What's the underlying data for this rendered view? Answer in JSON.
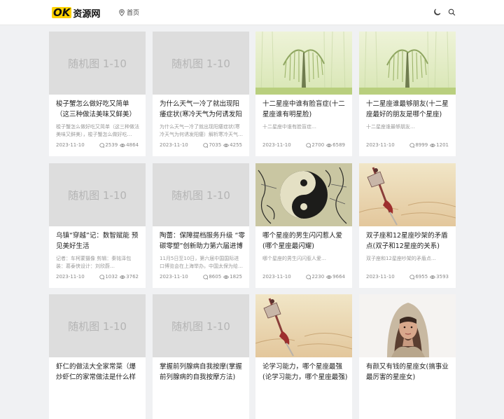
{
  "header": {
    "logo_mark": "OK",
    "logo_text": "资源网",
    "nav_home": "首页"
  },
  "placeholder_text": "随机图 1-10",
  "cards": [
    {
      "image": "placeholder",
      "title": "梭子蟹怎么做好吃又简单（这三种做法美味又鲜美）",
      "excerpt": "梭子蟹怎么做好吃又简单（这三种做法美味又鲜美），梭子蟹怎么做好吃…",
      "date": "2023-11-10",
      "comments": "2539",
      "views": "4864"
    },
    {
      "image": "placeholder",
      "title": "为什么天气一冷了就出现阳痿症状(寒冷天气为何诱发阳痿)",
      "excerpt": "为什么天气一冷了就出现阳痿症状(寒冷天气为何诱发阳痿）解析寒冷天气…",
      "date": "2023-11-10",
      "comments": "7035",
      "views": "4255"
    },
    {
      "image": "willow",
      "title": "十二星座中谁有脸盲症(十二星座谁有明星脸)",
      "excerpt": "十二星座中谁有脸盲症…",
      "date": "2023-11-10",
      "comments": "2700",
      "views": "6589"
    },
    {
      "image": "willow",
      "title": "十二星座谁最够朋友(十二星座最好的朋友是哪个星座)",
      "excerpt": "十二星座谁最够朋友…",
      "date": "2023-11-10",
      "comments": "8999",
      "views": "1201"
    },
    {
      "image": "placeholder",
      "title": "乌镇“穿越”记：数智赋能 预见美好生活",
      "excerpt": "记者：车柯蒙摄像 剪辑：秦铭泽包装：葛泰侠设计：刘欣蔚…",
      "date": "2023-11-10",
      "comments": "1032",
      "views": "3762"
    },
    {
      "image": "placeholder",
      "title": "陶蕾：保障提档服务升级 “零碳零塑”创新助力第六届进博会",
      "excerpt": "11月5日至10日，第六届中国国际进口博览会在上海举办。中国太保为给…",
      "date": "2023-11-10",
      "comments": "8605",
      "views": "1825"
    },
    {
      "image": "tiger",
      "title": "哪个星座的男生闪闪惹人爱(哪个星座最闪耀)",
      "excerpt": "哪个星座的男生闪闪惹人爱…",
      "date": "2023-11-10",
      "comments": "2230",
      "views": "9664"
    },
    {
      "image": "sword",
      "title": "双子座和12星座吵架的矛盾点(双子和12星座的关系)",
      "excerpt": "双子座和12星座吵架的矛盾点…",
      "date": "2023-11-10",
      "comments": "6955",
      "views": "3593"
    },
    {
      "image": "placeholder",
      "title": "虾仁的做法大全家常菜（爆炒虾仁的家常做法是什么样的）",
      "excerpt": "",
      "date": "",
      "comments": "",
      "views": ""
    },
    {
      "image": "placeholder",
      "title": "掌握前列腺病自我按摩(掌握前列腺病的自我按摩方法)",
      "excerpt": "",
      "date": "",
      "comments": "",
      "views": ""
    },
    {
      "image": "sword",
      "title": "论学习能力，哪个星座最强(论学习能力，哪个星座最强)",
      "excerpt": "",
      "date": "",
      "comments": "",
      "views": ""
    },
    {
      "image": "woman",
      "title": "有颜又有钱的星座女(搞事业最厉害的星座女)",
      "excerpt": "",
      "date": "",
      "comments": "",
      "views": ""
    }
  ],
  "colors": {
    "accent": "#ffd200",
    "page_bg": "#f0f1f3",
    "placeholder_bg": "#dddddd"
  }
}
